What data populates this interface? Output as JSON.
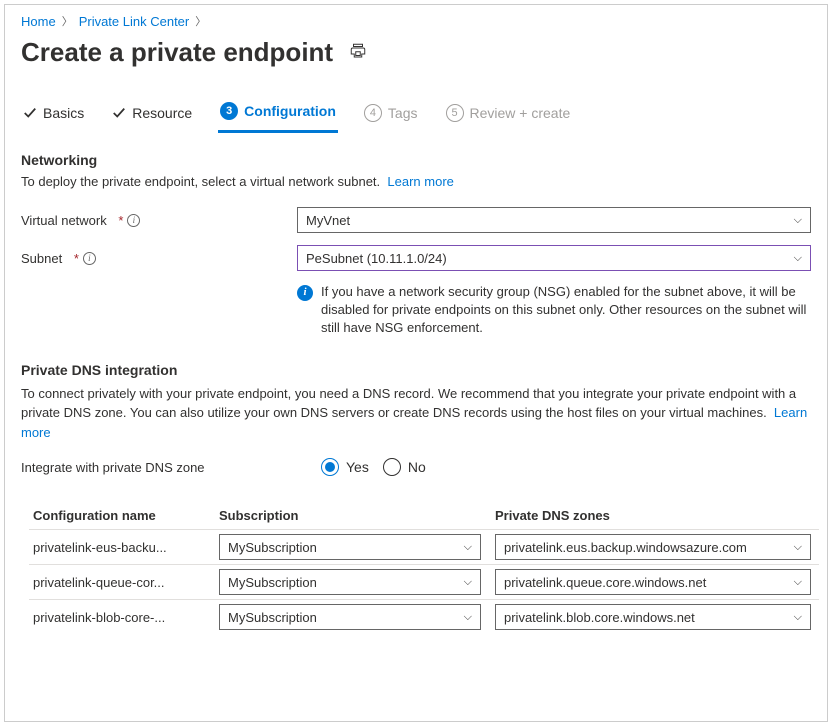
{
  "breadcrumb": {
    "home": "Home",
    "center": "Private Link Center"
  },
  "title": "Create a private endpoint",
  "tabs": {
    "basics": "Basics",
    "resource": "Resource",
    "configuration": {
      "num": "3",
      "label": "Configuration"
    },
    "tags": {
      "num": "4",
      "label": "Tags"
    },
    "review": {
      "num": "5",
      "label": "Review + create"
    }
  },
  "networking": {
    "title": "Networking",
    "desc": "To deploy the private endpoint, select a virtual network subnet.",
    "learn_more": "Learn more",
    "vnet_label": "Virtual network",
    "vnet_value": "MyVnet",
    "subnet_label": "Subnet",
    "subnet_value": "PeSubnet (10.11.1.0/24)",
    "callout": "If you have a network security group (NSG) enabled for the subnet above, it will be disabled for private endpoints on this subnet only. Other resources on the subnet will still have NSG enforcement."
  },
  "dns": {
    "title": "Private DNS integration",
    "desc": "To connect privately with your private endpoint, you need a DNS record. We recommend that you integrate your private endpoint with a private DNS zone. You can also utilize your own DNS servers or create DNS records using the host files on your virtual machines.",
    "learn_more": "Learn more",
    "integrate_label": "Integrate with private DNS zone",
    "yes": "Yes",
    "no": "No",
    "table": {
      "h1": "Configuration name",
      "h2": "Subscription",
      "h3": "Private DNS zones",
      "rows": [
        {
          "name": "privatelink-eus-backu...",
          "sub": "MySubscription",
          "zone": "privatelink.eus.backup.windowsazure.com"
        },
        {
          "name": "privatelink-queue-cor...",
          "sub": "MySubscription",
          "zone": "privatelink.queue.core.windows.net"
        },
        {
          "name": "privatelink-blob-core-...",
          "sub": "MySubscription",
          "zone": "privatelink.blob.core.windows.net"
        }
      ]
    }
  }
}
